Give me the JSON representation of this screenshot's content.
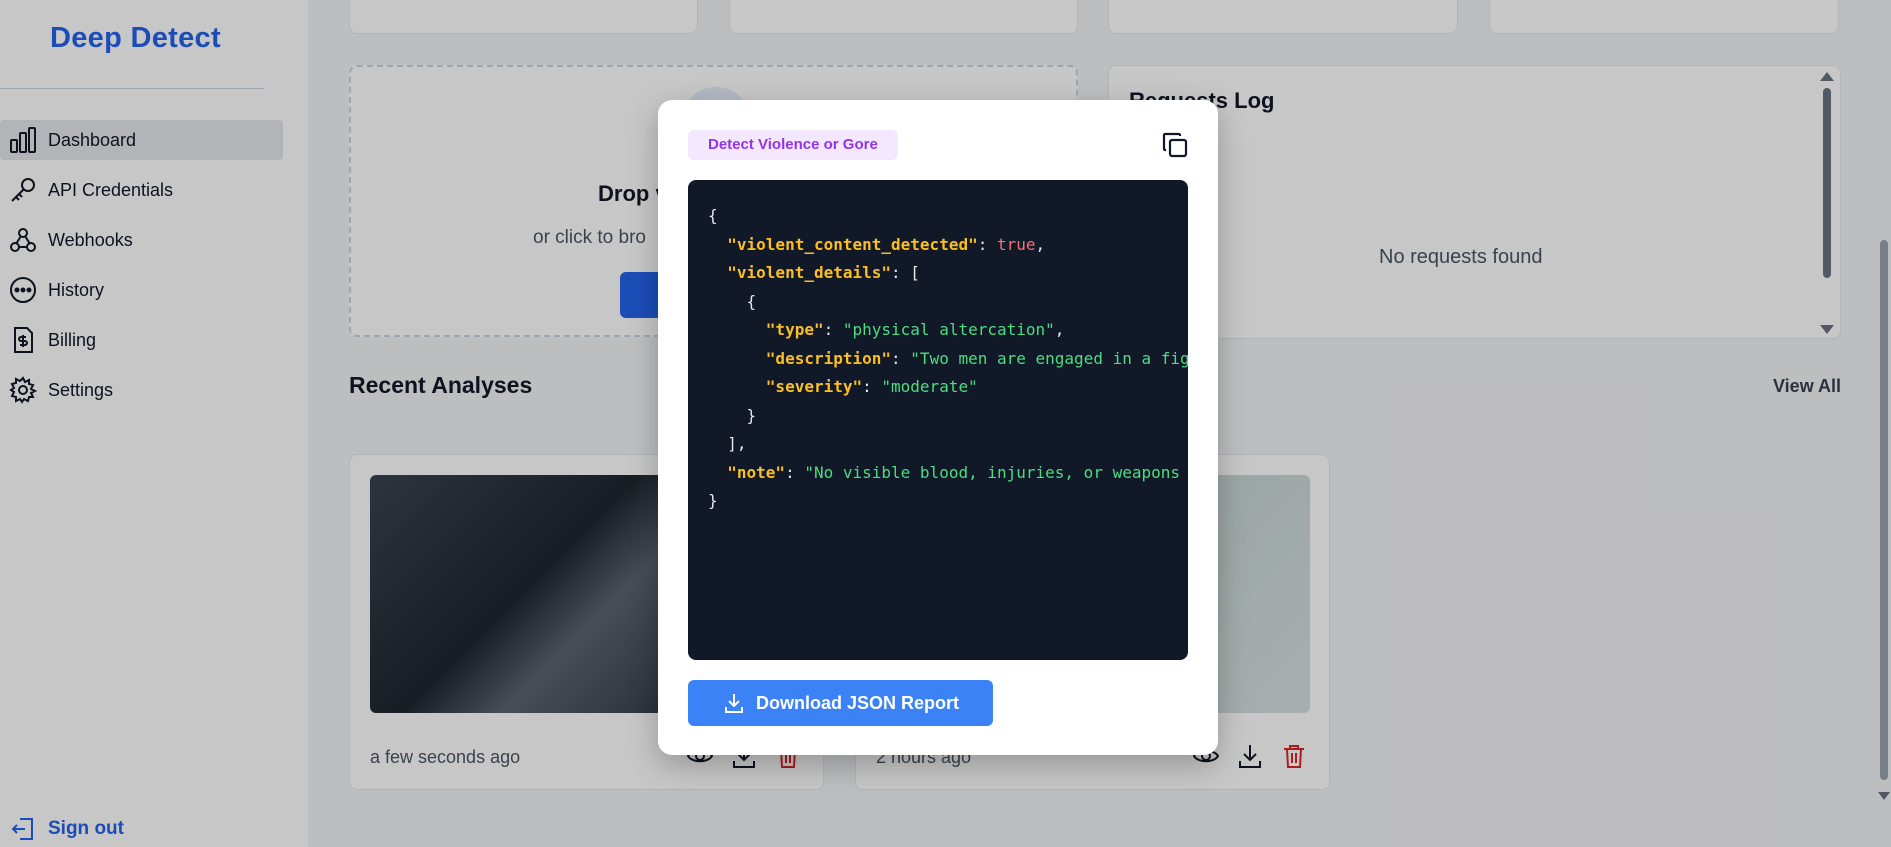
{
  "app": {
    "logo": "Deep Detect"
  },
  "sidebar": {
    "items": [
      {
        "label": "Dashboard",
        "icon": "bar-chart-icon",
        "active": true
      },
      {
        "label": "API Credentials",
        "icon": "key-icon"
      },
      {
        "label": "Webhooks",
        "icon": "webhook-icon"
      },
      {
        "label": "History",
        "icon": "history-icon"
      },
      {
        "label": "Billing",
        "icon": "billing-icon"
      },
      {
        "label": "Settings",
        "icon": "gear-icon"
      }
    ],
    "signout": "Sign out"
  },
  "upload": {
    "title": "Drop v",
    "subtitle": "or click to bro"
  },
  "requests_log": {
    "title": "Requests Log",
    "empty": "No requests found"
  },
  "recent": {
    "title": "Recent Analyses",
    "view_all": "View All",
    "cards": [
      {
        "time": "a few seconds ago"
      },
      {
        "time": "2 hours ago"
      }
    ]
  },
  "modal": {
    "badge": "Detect Violence or Gore",
    "download_label": "Download JSON Report",
    "json": {
      "key_violent_detected": "\"violent_content_detected\"",
      "val_violent_detected": "true",
      "key_violent_details": "\"violent_details\"",
      "key_type": "\"type\"",
      "val_type": "\"physical altercation\"",
      "key_description": "\"description\"",
      "val_description": "\"Two men are engaged in a fig",
      "key_severity": "\"severity\"",
      "val_severity": "\"moderate\"",
      "key_note": "\"note\"",
      "val_note": "\"No visible blood, injuries, or weapons"
    }
  },
  "colors": {
    "brand": "#2563eb",
    "badge_text": "#9333ea",
    "badge_bg": "#f3e8ff",
    "code_bg": "#111827",
    "json_key": "#fbbf24",
    "json_string": "#4ade80",
    "json_bool": "#f87171",
    "delete": "#dc2626"
  }
}
